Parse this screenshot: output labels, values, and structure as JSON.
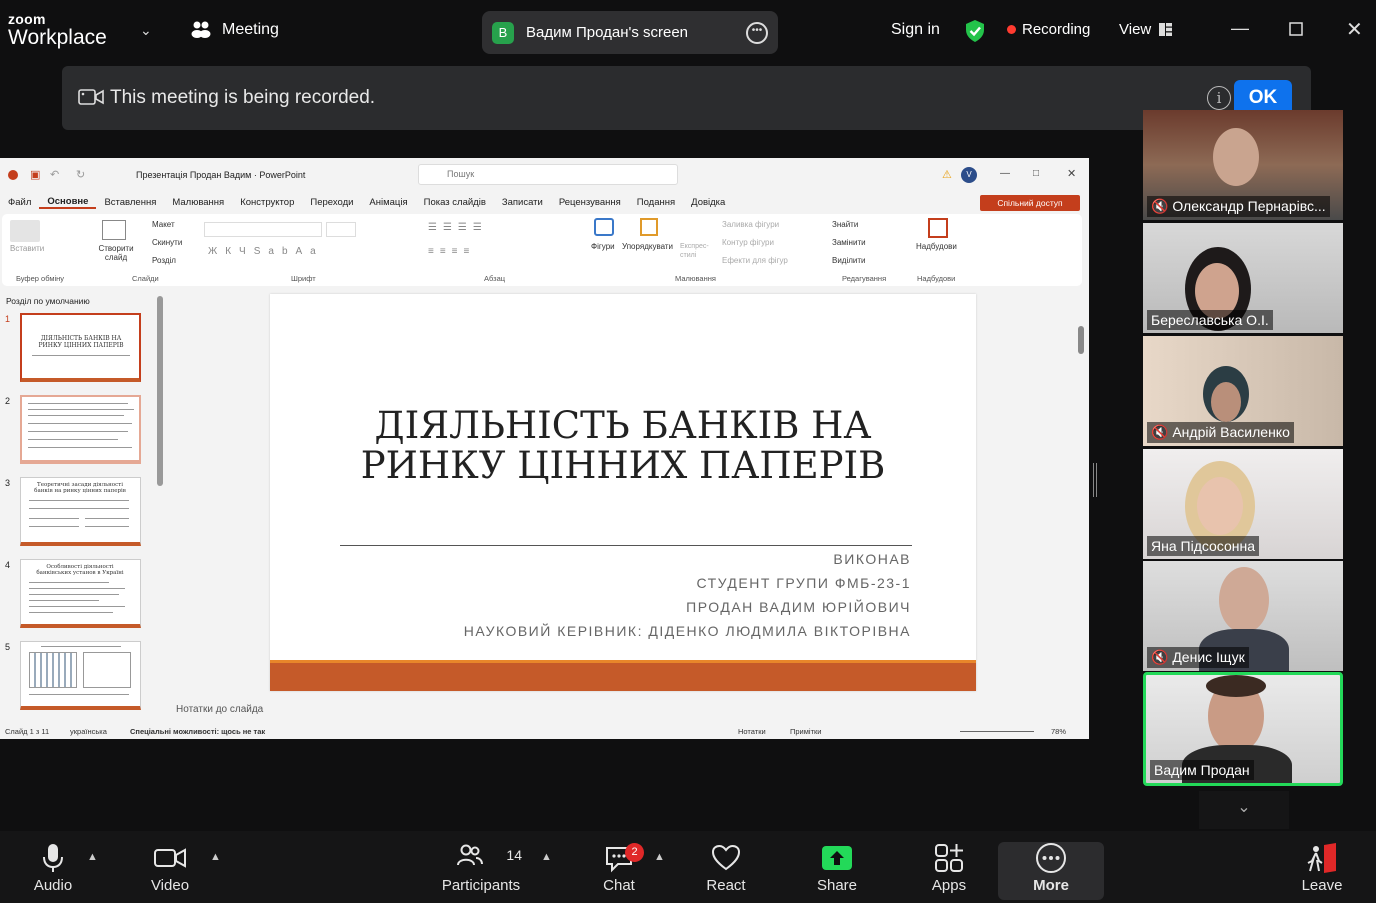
{
  "app": {
    "brand_top": "zoom",
    "brand_bottom": "Workplace",
    "meeting_label": "Meeting"
  },
  "share_pill": {
    "avatar_letter": "В",
    "title": "Вадим Продан's screen"
  },
  "header": {
    "sign_in": "Sign in",
    "recording": "Recording",
    "view": "View"
  },
  "banner": {
    "message": "This meeting is being recorded.",
    "ok": "OK"
  },
  "ppt": {
    "doc_title": "Презентація Продан Вадим  ·  PowerPoint",
    "search_placeholder": "Пошук",
    "avatar": "V",
    "tabs": [
      "Файл",
      "Основне",
      "Вставлення",
      "Малювання",
      "Конструктор",
      "Переходи",
      "Анімація",
      "Показ слайдів",
      "Записати",
      "Рецензування",
      "Подання",
      "Довідка"
    ],
    "share": "Спільний доступ",
    "groups": [
      "Буфер обміну",
      "Слайди",
      "Шрифт",
      "Абзац",
      "Малювання",
      "Редагування",
      "Надбудови"
    ],
    "buttons": {
      "paste": "Вставити",
      "new_slide": "Створити слайд",
      "layout": "Макет",
      "reset": "Скинути",
      "section": "Розділ",
      "shapes": "Фігури",
      "arrange": "Упорядкувати",
      "quick_styles": "Експрес-стилі",
      "fill": "Заливка фігури",
      "outline": "Контур фігури",
      "effects": "Ефекти для фігур",
      "find": "Знайти",
      "replace": "Замінити",
      "select": "Виділити",
      "addins": "Надбудови"
    },
    "section_label": "Розділ по умолчанию",
    "thumb_numbers": [
      "1",
      "2",
      "3",
      "4",
      "5"
    ],
    "thumb_titles": [
      "ДІЯЛЬНІСТЬ БАНКІВ НА РИНКУ ЦІННИХ ПАПЕРІВ",
      "",
      "Теоретичні засади діяльності банків на ринку цінних паперів",
      "Особливості діяльності банківських установ в Україні",
      ""
    ],
    "slide": {
      "title_line1": "ДІЯЛЬНІСТЬ БАНКІВ НА",
      "title_line2": "РИНКУ ЦІННИХ ПАПЕРІВ",
      "sub1": "ВИКОНАВ",
      "sub2": "СТУДЕНТ ГРУПИ ФМБ-23-1",
      "sub3": "ПРОДАН ВАДИМ ЮРІЙОВИЧ",
      "sub4": "НАУКОВИЙ КЕРІВНИК: ДІДЕНКО ЛЮДМИЛА ВІКТОРІВНА"
    },
    "notes": "Нотатки до слайда",
    "status": {
      "slide": "Слайд 1 з 11",
      "lang": "українська",
      "access": "Спеціальні можливості: щось не так",
      "notes": "Нотатки",
      "comments": "Примітки",
      "zoom": "78%"
    }
  },
  "participants": [
    {
      "name": "Олександр Пернарівс...",
      "muted": true
    },
    {
      "name": "Береславська О.І.",
      "muted": false
    },
    {
      "name": "Андрій Василенко",
      "muted": true
    },
    {
      "name": "Яна Підсосонна",
      "muted": false
    },
    {
      "name": "Денис Іщук",
      "muted": true
    },
    {
      "name": "Вадим Продан",
      "muted": false
    }
  ],
  "toolbar": {
    "audio": "Audio",
    "video": "Video",
    "participants": "Participants",
    "participants_count": "14",
    "chat": "Chat",
    "chat_badge": "2",
    "react": "React",
    "share": "Share",
    "apps": "Apps",
    "more": "More",
    "leave": "Leave"
  },
  "colors": {
    "accent": "#0e72ed",
    "share_green": "#23d959",
    "ppt_red": "#c43e1c",
    "slide_bar": "#c55a29",
    "leave_red": "#e02828"
  }
}
